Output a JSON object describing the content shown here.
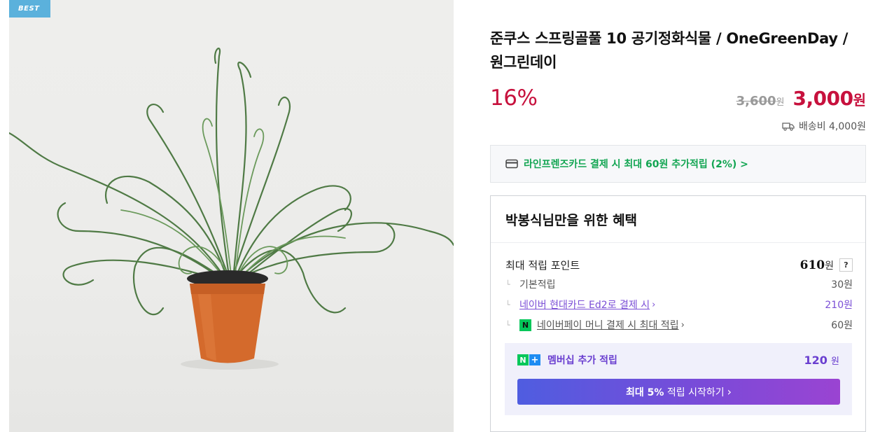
{
  "image": {
    "badge": "BEST",
    "alt_icon": "plant-photo"
  },
  "product": {
    "title": "준쿠스 스프링골풀 10 공기정화식물 / OneGreenDay / 원그린데이",
    "discount": "16%",
    "original_price": "3,600",
    "original_unit": "원",
    "sale_price": "3,000",
    "sale_unit": "원",
    "shipping_icon": "truck-icon",
    "shipping": "배송비 4,000원"
  },
  "card_promo": {
    "icon": "credit-card-icon",
    "text": "라인프렌즈카드 결제 시 최대 60원 추가적립 (2%) >"
  },
  "benefits": {
    "title": "박봉식님만을 위한 혜택",
    "max_points_label": "최대 적립 포인트",
    "max_points_value": "610",
    "max_points_unit": "원",
    "help": "?",
    "items": [
      {
        "label": "기본적립",
        "value": "30원"
      },
      {
        "label": "네이버 현대카드 Ed2로 결제 시",
        "value": "210원"
      },
      {
        "label": "네이버페이 머니 결제 시 최대 적립",
        "value": "60원"
      }
    ],
    "membership": {
      "label": "멤버십 추가 적립",
      "value": "120",
      "unit": "원",
      "button_bold": "최대 5%",
      "button_rest": " 적립 시작하기",
      "button_chevron": "›"
    }
  },
  "colors": {
    "accent_red": "#c7113d",
    "green": "#12a552",
    "purple": "#7b4fd6",
    "badge_blue": "#5bb1dc"
  }
}
